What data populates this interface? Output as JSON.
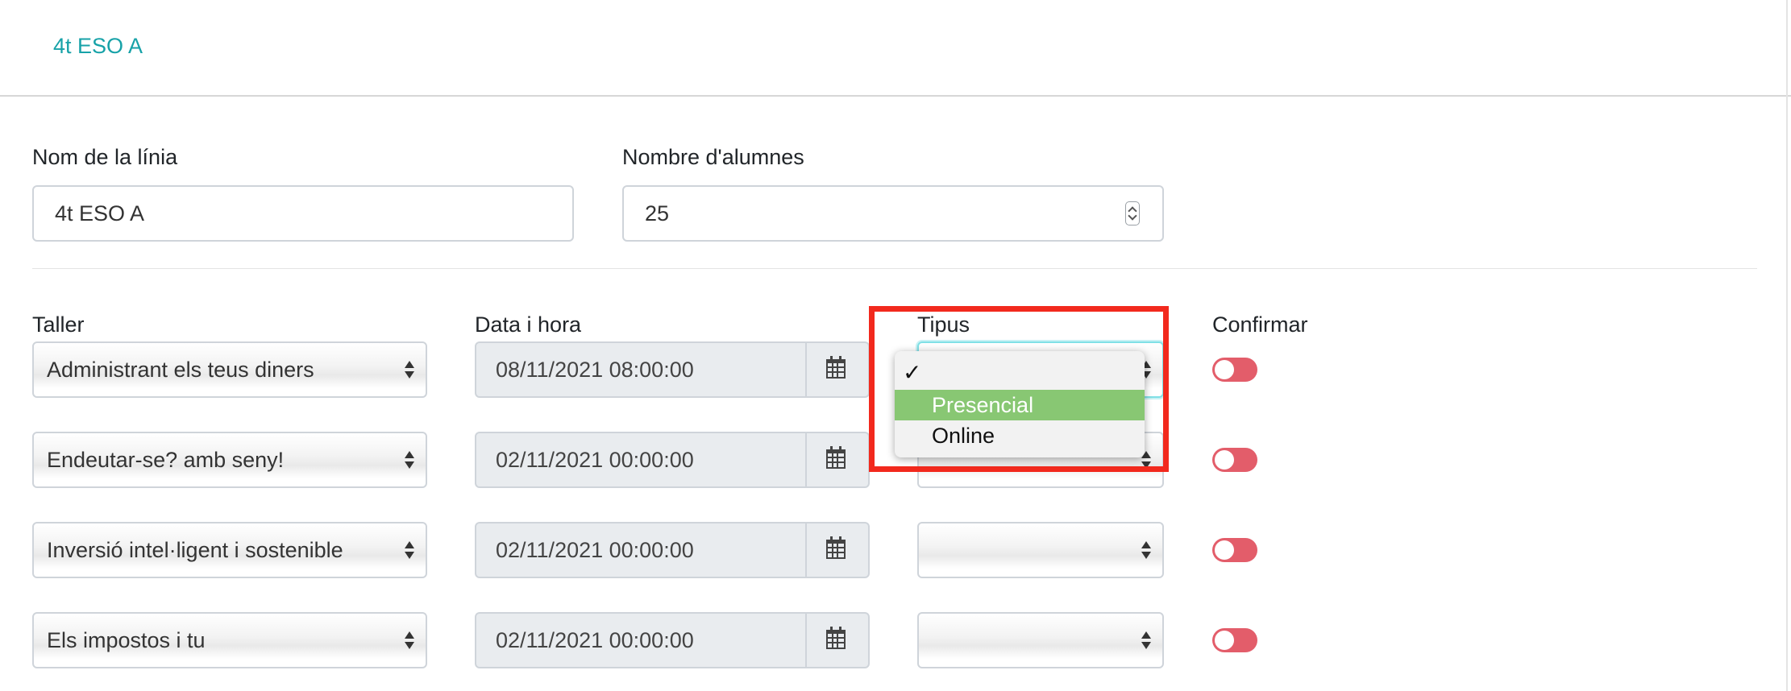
{
  "header": {
    "tab_label": "4t ESO A"
  },
  "form": {
    "line_name_label": "Nom de la línia",
    "line_name_value": "4t ESO A",
    "students_label": "Nombre d'alumnes",
    "students_value": "25"
  },
  "table": {
    "columns": {
      "taller": "Taller",
      "data": "Data i hora",
      "tipus": "Tipus",
      "confirmar": "Confirmar"
    },
    "rows": [
      {
        "taller": "Administrant els teus diners",
        "datetime": "08/11/2021 08:00:00",
        "tipus": "",
        "confirmed": false
      },
      {
        "taller": "Endeutar-se? amb seny!",
        "datetime": "02/11/2021 00:00:00",
        "tipus": "",
        "confirmed": false
      },
      {
        "taller": "Inversió intel·ligent i sostenible",
        "datetime": "02/11/2021 00:00:00",
        "tipus": "",
        "confirmed": false
      },
      {
        "taller": "Els impostos i tu",
        "datetime": "02/11/2021 00:00:00",
        "tipus": "",
        "confirmed": false
      }
    ]
  },
  "dropdown": {
    "check_mark": "✓",
    "options": [
      "Presencial",
      "Online"
    ],
    "highlighted_option": "Presencial"
  },
  "colors": {
    "accent": "#17a2a8",
    "toggle_off": "#e35d6a",
    "highlight_option": "#88c773",
    "annotation_box": "#f2291d"
  },
  "icons": {
    "calendar": "calendar-icon",
    "spinner": "number-spinner-icon",
    "select_arrows": "select-arrows-icon"
  }
}
